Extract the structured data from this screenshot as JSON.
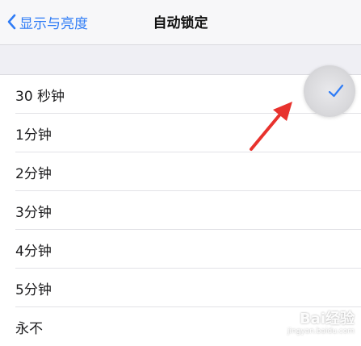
{
  "nav": {
    "back_label": "显示与亮度",
    "title": "自动锁定"
  },
  "options": [
    {
      "label": "30 秒钟",
      "selected": true
    },
    {
      "label": "1分钟"
    },
    {
      "label": "2分钟"
    },
    {
      "label": "3分钟"
    },
    {
      "label": "4分钟"
    },
    {
      "label": "5分钟"
    },
    {
      "label": "永不"
    }
  ],
  "icons": {
    "back": "chevron-left-icon",
    "check": "checkmark-icon",
    "annotation": "red-arrow-icon"
  },
  "colors": {
    "accent": "#2f7cf6",
    "annotation": "#e8322d"
  },
  "watermark": {
    "brand": "Bai经验",
    "url": "jingyan.baidu.com"
  }
}
